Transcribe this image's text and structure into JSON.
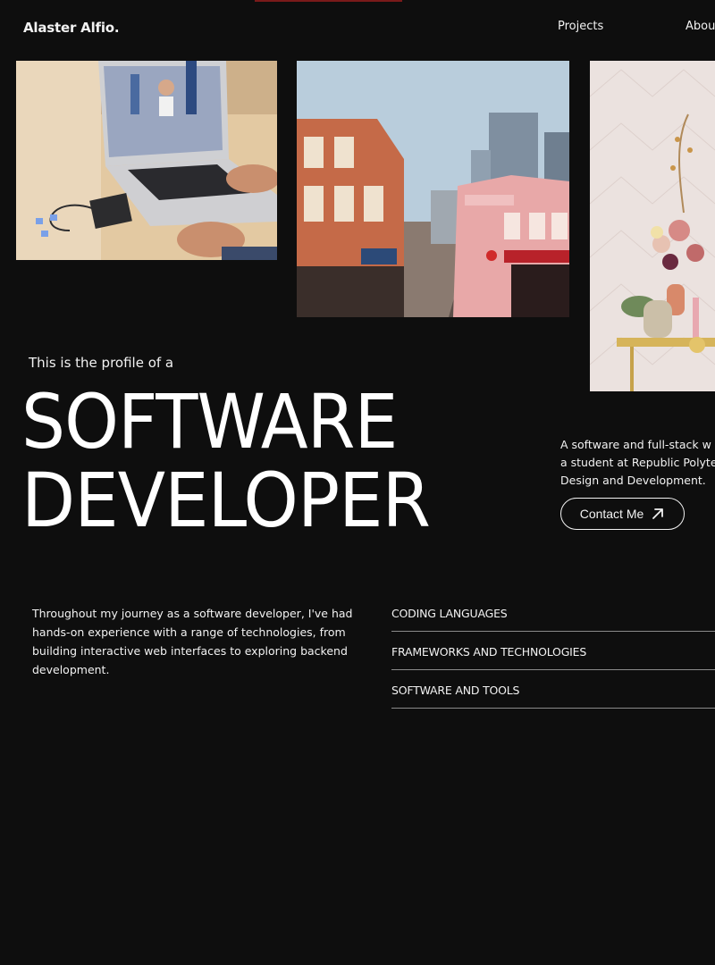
{
  "header": {
    "logo": "Alaster Alfio.",
    "nav": [
      "Projects",
      "About"
    ]
  },
  "photos": [
    {
      "name": "laptop-photo",
      "description_icon": "photo"
    },
    {
      "name": "street-photo",
      "description_icon": "photo"
    },
    {
      "name": "flowers-photo",
      "description_icon": "photo"
    }
  ],
  "hero": {
    "intro": "This is the profile of a",
    "title_line1": "SOFTWARE",
    "title_line2": "DEVELOPER",
    "bio_lines": [
      "A software and full-stack w",
      "a student at Republic Polyte",
      "Design and Development."
    ],
    "contact_label": "Contact Me"
  },
  "journey": {
    "text": "Throughout my journey as a software developer, I've had hands-on experience with a range of technologies, from building interactive web interfaces to exploring backend development."
  },
  "skills": [
    "CODING LANGUAGES",
    "FRAMEWORKS AND TECHNOLOGIES",
    "SOFTWARE AND TOOLS"
  ],
  "colors": {
    "background": "#0e0e0e",
    "text": "#f2f2f2",
    "divider": "#8a8a8a"
  }
}
